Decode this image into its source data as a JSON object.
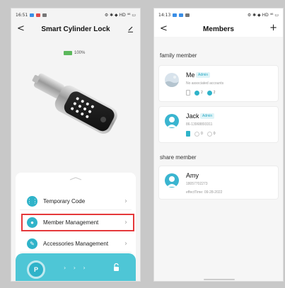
{
  "left_phone": {
    "status": {
      "time": "16:51",
      "right": "⚙ ✱ ◆ HD ⁴⁶ ▭"
    },
    "title": "Smart Cylinder Lock",
    "back": "<",
    "battery": "100%",
    "menu": [
      {
        "label": "Temporary Code",
        "icon": "grid-icon"
      },
      {
        "label": "Member Management",
        "icon": "person-icon"
      },
      {
        "label": "Accessories Management",
        "icon": "wrench-icon"
      }
    ],
    "arrow": "›",
    "unlock_knob": "P",
    "chevrons": "› › ›"
  },
  "right_phone": {
    "status": {
      "time": "14:13",
      "right": "⚙ ✱ ◆ HD ⁴⁶ ▭"
    },
    "title": "Members",
    "back": "<",
    "add": "+",
    "family_title": "family member",
    "share_title": "share member",
    "family": [
      {
        "name": "Me",
        "badge": "Admin",
        "sub": "No associated accounts",
        "count1": "2",
        "count2": "2"
      },
      {
        "name": "Jack",
        "badge": "Admin",
        "sub": "86-13968893311",
        "count1": "0",
        "count2": "0"
      }
    ],
    "share": [
      {
        "name": "Amy",
        "phone": "18057702273",
        "effect": "effectTime: 09-28-2022"
      }
    ]
  }
}
